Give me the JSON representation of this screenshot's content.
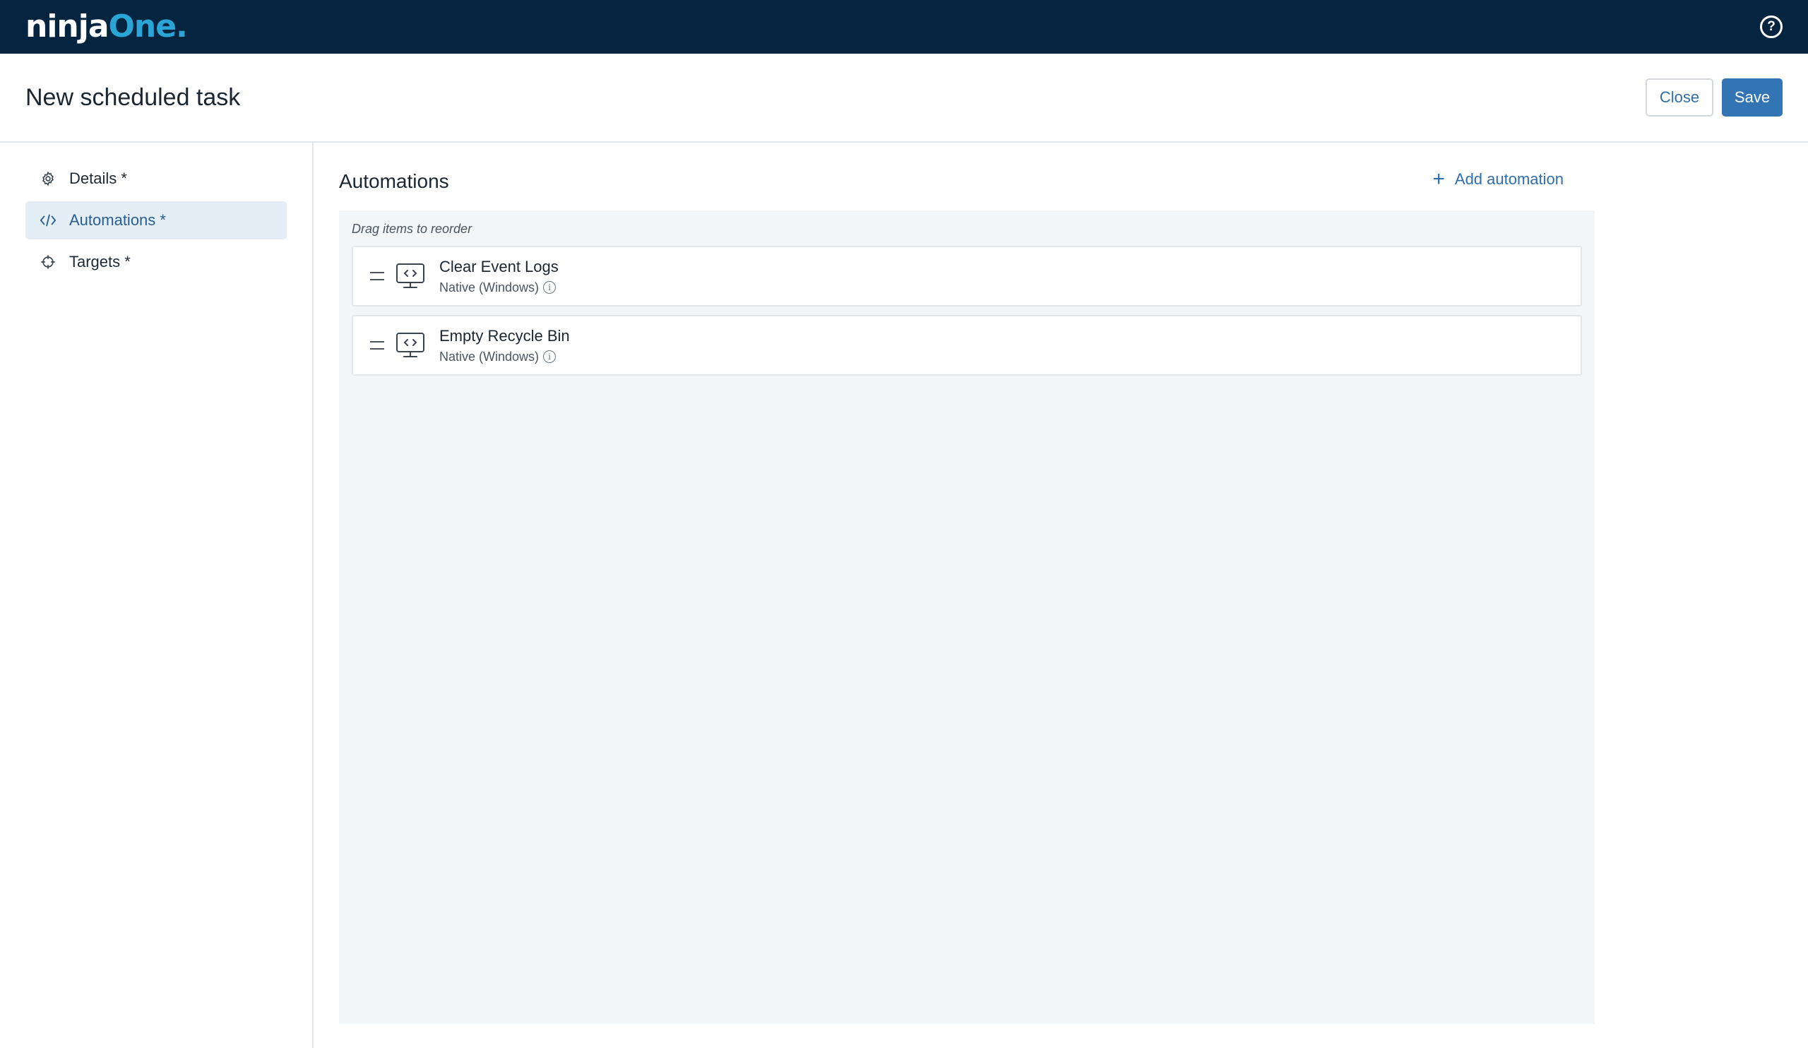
{
  "topbar": {
    "logo": {
      "ninja": "ninja",
      "one": "One",
      "dot": "."
    },
    "help_icon": "question-circle-icon",
    "help_glyph": "?"
  },
  "header": {
    "title": "New scheduled task",
    "close_label": "Close",
    "save_label": "Save"
  },
  "sidebar": {
    "items": [
      {
        "label": "Details *",
        "icon": "gear-icon",
        "active": false
      },
      {
        "label": "Automations *",
        "icon": "code-icon",
        "active": true
      },
      {
        "label": "Targets *",
        "icon": "crosshair-icon",
        "active": false
      }
    ]
  },
  "main": {
    "section_title": "Automations",
    "add_label": "Add automation",
    "add_glyph": "+",
    "hint": "Drag items to reorder",
    "automations": [
      {
        "name": "Clear Event Logs",
        "type": "Native (Windows)",
        "icon": "monitor-code-icon"
      },
      {
        "name": "Empty Recycle Bin",
        "type": "Native (Windows)",
        "icon": "monitor-code-icon"
      }
    ],
    "info_glyph": "i"
  },
  "colors": {
    "topbar_bg": "#04243f",
    "accent": "#3274b4",
    "logo_accent": "#2aa5d6",
    "active_nav_bg": "#e4eef7",
    "panel_bg": "#f2f6f8"
  }
}
